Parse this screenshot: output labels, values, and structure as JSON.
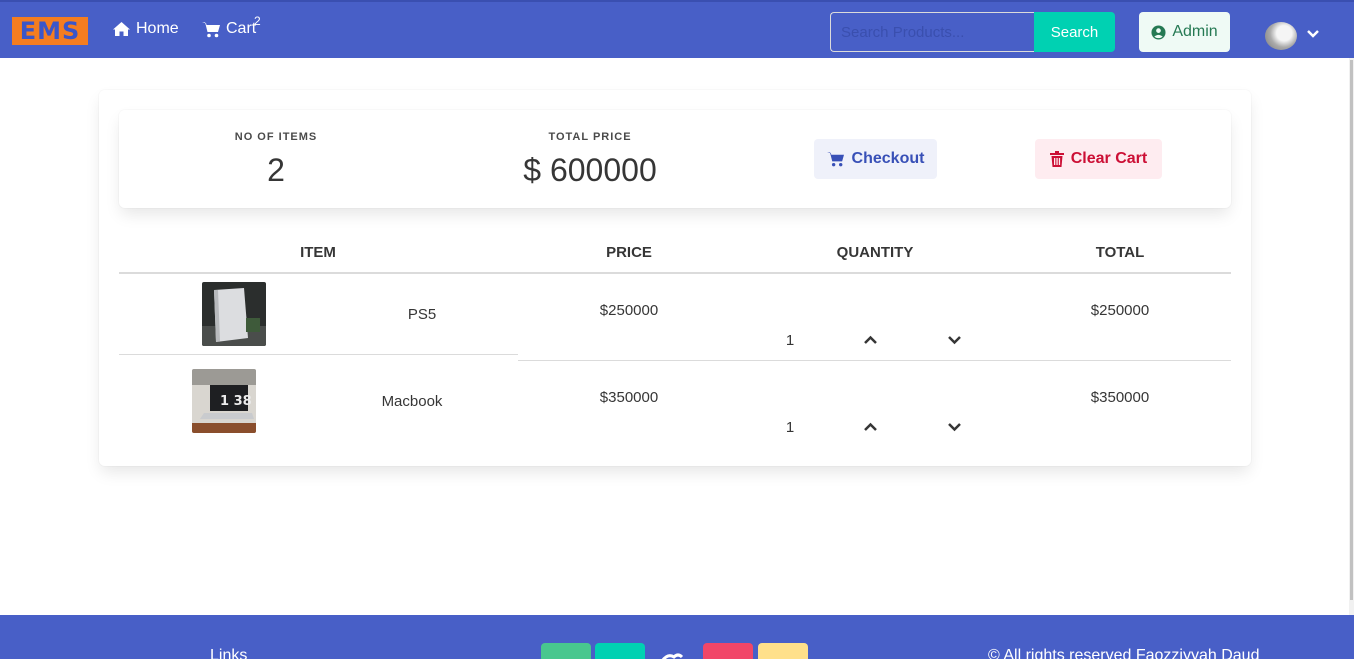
{
  "nav": {
    "logo": "EMS",
    "home_label": "Home",
    "cart_label": "Cart",
    "cart_count": "2",
    "search_placeholder": "Search Products...",
    "search_button": "Search",
    "admin_button": "Admin"
  },
  "summary": {
    "items_heading": "No of Items",
    "items_value": "2",
    "price_heading": "Total Price",
    "price_value": "$ 600000",
    "checkout_label": "Checkout",
    "clear_label": "Clear Cart"
  },
  "table": {
    "headers": [
      "ITEM",
      "PRICE",
      "QUANTITY",
      "TOTAL"
    ],
    "rows": [
      {
        "name": "PS5",
        "price": "$250000",
        "quantity": "1",
        "total": "$250000"
      },
      {
        "name": "Macbook",
        "price": "$350000",
        "quantity": "1",
        "total": "$350000"
      }
    ]
  },
  "footer": {
    "links_label": "Links",
    "copyright": "© All rights reserved Faozziyyah Daud"
  },
  "colors": {
    "navbar": "#485fc7",
    "logo_bg": "#f47d20",
    "search_button": "#00d1b2",
    "admin_text": "#257953",
    "checkout_text": "#3850b7",
    "clear_text": "#cc0f35",
    "social_green": "#48c78e",
    "social_teal": "#00d1b2",
    "social_pink": "#f14668",
    "social_yellow": "#ffe08a"
  }
}
